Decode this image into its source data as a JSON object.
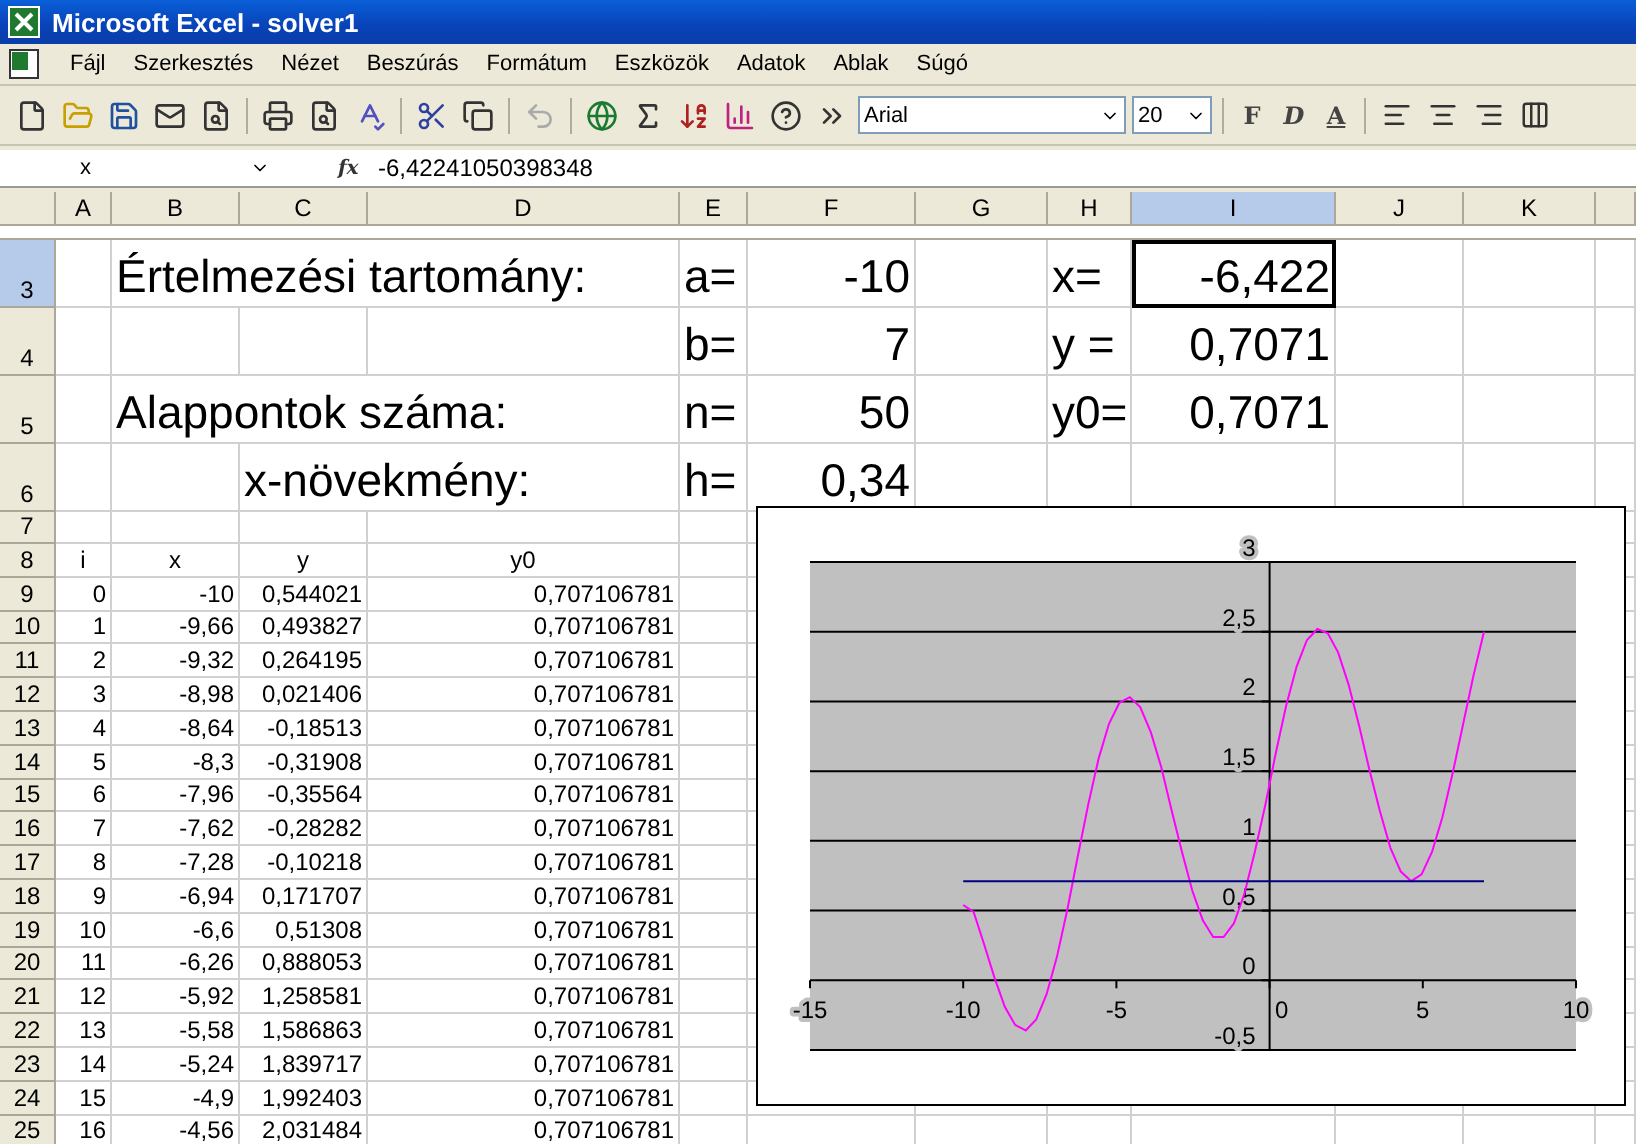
{
  "window": {
    "title": "Microsoft Excel - solver1"
  },
  "menu": [
    "Fájl",
    "Szerkesztés",
    "Nézet",
    "Beszúrás",
    "Formátum",
    "Eszközök",
    "Adatok",
    "Ablak",
    "Súgó"
  ],
  "toolbar": {
    "font": "Arial",
    "size": "20",
    "format_buttons": [
      "F",
      "D",
      "A"
    ]
  },
  "formula_bar": {
    "name_box": "x",
    "function_label": "fx",
    "value": "-6,42241050398348"
  },
  "columns": [
    {
      "label": "A",
      "selected": false
    },
    {
      "label": "B",
      "selected": false
    },
    {
      "label": "C",
      "selected": false
    },
    {
      "label": "D",
      "selected": false
    },
    {
      "label": "E",
      "selected": false
    },
    {
      "label": "F",
      "selected": false
    },
    {
      "label": "G",
      "selected": false
    },
    {
      "label": "H",
      "selected": false
    },
    {
      "label": "I",
      "selected": true
    },
    {
      "label": "J",
      "selected": false
    },
    {
      "label": "K",
      "selected": false
    }
  ],
  "parameters": [
    {
      "row": "3",
      "row_selected": true,
      "label": "Értelmezési tartomány:",
      "kind": "label",
      "var": "a=",
      "value": "-10",
      "result_label": "x=",
      "result": "-6,422",
      "selected": true
    },
    {
      "row": "4",
      "row_selected": false,
      "var": "b=",
      "value": "7",
      "result_label": "y =",
      "result": "0,7071",
      "selected": false
    },
    {
      "row": "5",
      "row_selected": false,
      "label": "Alappontok száma:",
      "kind": "label",
      "var": "n=",
      "value": "50",
      "result_label": "y0=",
      "result": "0,7071",
      "selected": false
    },
    {
      "row": "6",
      "row_selected": false,
      "label": "x-növekmény:",
      "kind": "sublabel",
      "var": "h=",
      "value": "0,34"
    }
  ],
  "spacer_row": "7",
  "table": {
    "header": {
      "row": "8",
      "cells": [
        "i",
        "x",
        "y",
        "y0"
      ]
    },
    "rows": [
      {
        "row": "9",
        "cells": [
          "0",
          "-10",
          "0,544021",
          "0,707106781"
        ]
      },
      {
        "row": "10",
        "cells": [
          "1",
          "-9,66",
          "0,493827",
          "0,707106781"
        ]
      },
      {
        "row": "11",
        "cells": [
          "2",
          "-9,32",
          "0,264195",
          "0,707106781"
        ]
      },
      {
        "row": "12",
        "cells": [
          "3",
          "-8,98",
          "0,021406",
          "0,707106781"
        ]
      },
      {
        "row": "13",
        "cells": [
          "4",
          "-8,64",
          "-0,18513",
          "0,707106781"
        ]
      },
      {
        "row": "14",
        "cells": [
          "5",
          "-8,3",
          "-0,31908",
          "0,707106781"
        ]
      },
      {
        "row": "15",
        "cells": [
          "6",
          "-7,96",
          "-0,35564",
          "0,707106781"
        ]
      },
      {
        "row": "16",
        "cells": [
          "7",
          "-7,62",
          "-0,28282",
          "0,707106781"
        ]
      },
      {
        "row": "17",
        "cells": [
          "8",
          "-7,28",
          "-0,10218",
          "0,707106781"
        ]
      },
      {
        "row": "18",
        "cells": [
          "9",
          "-6,94",
          "0,171707",
          "0,707106781"
        ]
      },
      {
        "row": "19",
        "cells": [
          "10",
          "-6,6",
          "0,51308",
          "0,707106781"
        ]
      },
      {
        "row": "20",
        "cells": [
          "11",
          "-6,26",
          "0,888053",
          "0,707106781"
        ]
      },
      {
        "row": "21",
        "cells": [
          "12",
          "-5,92",
          "1,258581",
          "0,707106781"
        ]
      },
      {
        "row": "22",
        "cells": [
          "13",
          "-5,58",
          "1,586863",
          "0,707106781"
        ]
      },
      {
        "row": "23",
        "cells": [
          "14",
          "-5,24",
          "1,839717",
          "0,707106781"
        ]
      },
      {
        "row": "24",
        "cells": [
          "15",
          "-4,9",
          "1,992403",
          "0,707106781"
        ]
      },
      {
        "row": "25",
        "cells": [
          "16",
          "-4,56",
          "2,031484",
          "0,707106781"
        ]
      }
    ]
  },
  "chart": {
    "chart_data": {
      "type": "line",
      "x": [
        -10,
        -9.66,
        -9.32,
        -8.98,
        -8.64,
        -8.3,
        -7.96,
        -7.62,
        -7.28,
        -6.94,
        -6.6,
        -6.26,
        -5.92,
        -5.58,
        -5.24,
        -4.9,
        -4.56,
        -4.22,
        -3.88,
        -3.54,
        -3.2,
        -2.86,
        -2.52,
        -2.18,
        -1.84,
        -1.5,
        -1.16,
        -0.82,
        -0.48,
        -0.14,
        0.2,
        0.54,
        0.88,
        1.22,
        1.56,
        1.9,
        2.24,
        2.58,
        2.92,
        3.26,
        3.6,
        3.94,
        4.28,
        4.62,
        4.96,
        5.3,
        5.64,
        5.98,
        6.32,
        6.66,
        7
      ],
      "series": [
        {
          "color": "#ff00ff",
          "values": [
            0.54,
            0.49,
            0.26,
            0.02,
            -0.19,
            -0.32,
            -0.36,
            -0.28,
            -0.1,
            0.17,
            0.51,
            0.89,
            1.26,
            1.59,
            1.84,
            1.99,
            2.03,
            1.96,
            1.78,
            1.53,
            1.22,
            0.92,
            0.64,
            0.43,
            0.31,
            0.31,
            0.41,
            0.62,
            0.92,
            1.26,
            1.63,
            1.97,
            2.25,
            2.44,
            2.52,
            2.49,
            2.35,
            2.12,
            1.83,
            1.51,
            1.21,
            0.95,
            0.78,
            0.71,
            0.76,
            0.92,
            1.17,
            1.49,
            1.84,
            2.19,
            2.5
          ]
        },
        {
          "color": "#000080",
          "values": [
            0.71,
            0.71,
            0.71,
            0.71,
            0.71,
            0.71,
            0.71,
            0.71,
            0.71,
            0.71,
            0.71,
            0.71,
            0.71,
            0.71,
            0.71,
            0.71,
            0.71,
            0.71,
            0.71,
            0.71,
            0.71,
            0.71,
            0.71,
            0.71,
            0.71,
            0.71,
            0.71,
            0.71,
            0.71,
            0.71,
            0.71,
            0.71,
            0.71,
            0.71,
            0.71,
            0.71,
            0.71,
            0.71,
            0.71,
            0.71,
            0.71,
            0.71,
            0.71,
            0.71,
            0.71,
            0.71,
            0.71,
            0.71,
            0.71,
            0.71,
            0.71
          ]
        }
      ],
      "grid": true,
      "xlim": [
        -15,
        10
      ],
      "ylim": [
        -0.5,
        3
      ],
      "xticks": [
        -15,
        -10,
        -5,
        0,
        5,
        10
      ],
      "yticks": [
        {
          "value": -0.5,
          "label": "-0,5"
        },
        0,
        {
          "value": 0.5,
          "label": "0,5"
        },
        1,
        {
          "value": 1.5,
          "label": "1,5"
        },
        2,
        {
          "value": 2.5,
          "label": "2,5"
        },
        3
      ]
    }
  }
}
